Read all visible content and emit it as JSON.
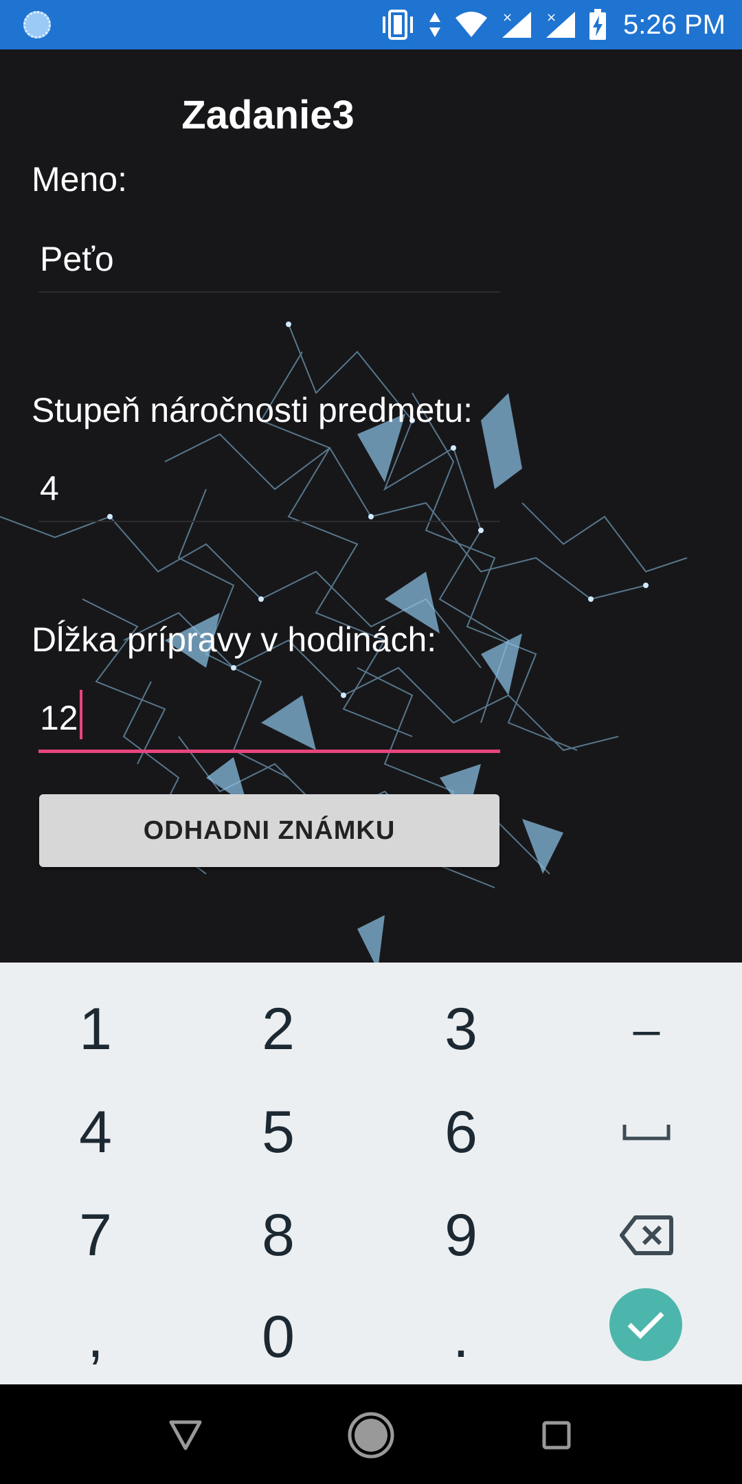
{
  "status_bar": {
    "time": "5:26 PM",
    "icons": [
      "loading-icon",
      "vibrate-icon",
      "data-arrows-icon",
      "wifi-icon",
      "signal-icon",
      "signal-icon",
      "battery-charging-icon"
    ]
  },
  "app": {
    "title": "Zadanie3",
    "name_label": "Meno:",
    "name_value": "Peťo",
    "difficulty_label": "Stupeň náročnosti predmetu:",
    "difficulty_value": "4",
    "prep_label": "Dĺžka prípravy v hodinách:",
    "prep_value": "12",
    "estimate_button": "ODHADNI ZNÁMKU"
  },
  "keyboard": {
    "keys": [
      "1",
      "2",
      "3",
      "–",
      "4",
      "5",
      "6",
      "␣",
      "7",
      "8",
      "9",
      "backspace",
      ",",
      "0",
      ".",
      "done"
    ]
  },
  "colors": {
    "status_bar": "#1f74d1",
    "accent": "#e8457c",
    "done_button": "#4db6ac",
    "keyboard_bg": "#eceff1"
  }
}
